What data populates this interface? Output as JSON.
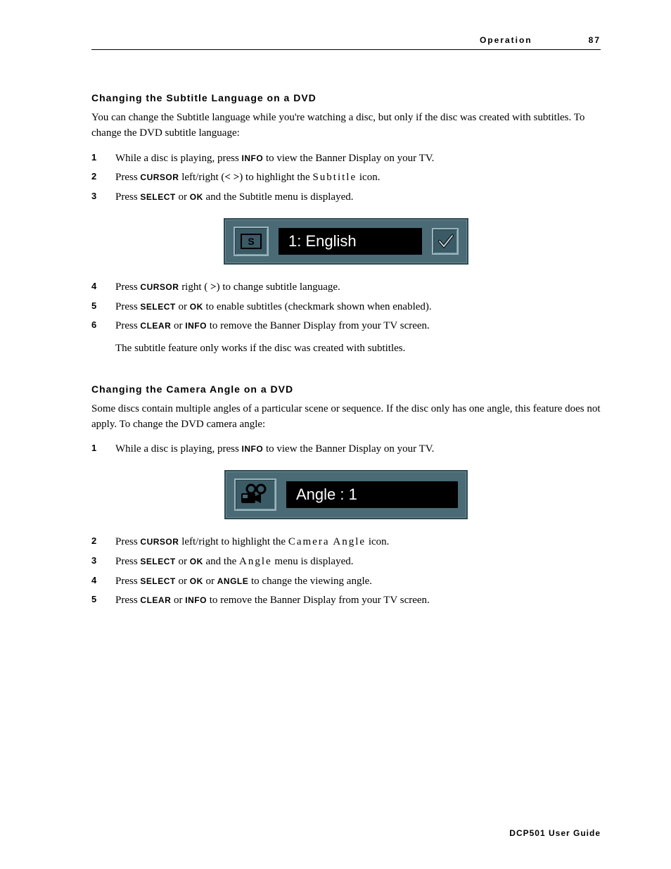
{
  "header": {
    "section": "Operation",
    "page": "87"
  },
  "section1": {
    "heading": "Changing the Subtitle Language on a DVD",
    "intro": "You can change the Subtitle language while you're watching a disc, but only if the disc was created with subtitles. To change the DVD subtitle language:",
    "steps": {
      "1": {
        "num": "1",
        "pre": "While a disc is playing, press ",
        "key1": "INFO",
        "post": " to view the Banner Display on your TV."
      },
      "2": {
        "num": "2",
        "pre": "Press ",
        "key1": "CURSOR",
        "mid": " left/right (",
        "sym": "< >",
        "mid2": ") to highlight the ",
        "spaced": "Subtitle",
        "post": " icon."
      },
      "3": {
        "num": "3",
        "pre": "Press ",
        "key1": "SELECT",
        "mid": " or ",
        "key2": "OK",
        "post": " and the Subtitle menu is displayed."
      },
      "4": {
        "num": "4",
        "pre": "Press ",
        "key1": "CURSOR",
        "mid": " right ( ",
        "sym": ">",
        "mid2": ") to change subtitle language."
      },
      "5": {
        "num": "5",
        "pre": "Press ",
        "key1": "SELECT",
        "mid": " or ",
        "key2": "OK",
        "post": " to enable subtitles (checkmark shown when enabled)."
      },
      "6": {
        "num": "6",
        "pre": "Press ",
        "key1": "CLEAR",
        "mid": " or ",
        "key2": "INFO",
        "post": " to remove the Banner Display from your TV screen."
      }
    },
    "note": "The subtitle feature only works if the disc was created with subtitles.",
    "banner_text": "1: English"
  },
  "section2": {
    "heading": "Changing the Camera Angle on a DVD",
    "intro": "Some discs contain multiple angles of a particular scene or sequence. If the disc only has one angle, this feature does not apply. To change the DVD camera angle:",
    "steps": {
      "1": {
        "num": "1",
        "pre": "While a disc is playing, press ",
        "key1": "INFO",
        "post": " to view the Banner Display on your TV."
      },
      "2": {
        "num": "2",
        "pre": "Press ",
        "key1": "CURSOR",
        "mid": " left/right to highlight the ",
        "spaced": "Camera Angle",
        "post": " icon."
      },
      "3": {
        "num": "3",
        "pre": "Press ",
        "key1": "SELECT",
        "mid": " or ",
        "key2": "OK",
        "mid2": " and the ",
        "spaced": "Angle",
        "post": " menu is displayed."
      },
      "4": {
        "num": "4",
        "pre": "Press ",
        "key1": "SELECT",
        "mid": " or ",
        "key2": "OK",
        "mid2": " or ",
        "key3": "ANGLE",
        "post": " to change the viewing angle."
      },
      "5": {
        "num": "5",
        "pre": "Press ",
        "key1": "CLEAR",
        "mid": " or ",
        "key2": "INFO",
        "post": " to remove the Banner Display from your TV screen."
      }
    },
    "banner_text": "Angle : 1"
  },
  "footer": "DCP501 User Guide"
}
